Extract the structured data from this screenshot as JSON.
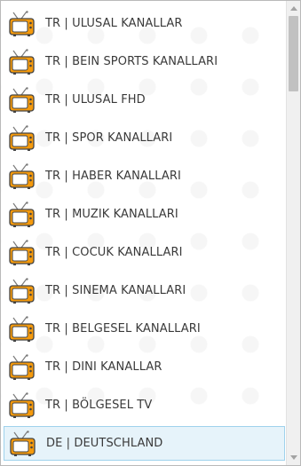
{
  "channels": [
    {
      "label": "TR | ULUSAL KANALLAR",
      "icon": "tv-icon",
      "selected": false
    },
    {
      "label": "TR | BEIN SPORTS KANALLARI",
      "icon": "tv-icon",
      "selected": false
    },
    {
      "label": "TR | ULUSAL FHD",
      "icon": "tv-icon",
      "selected": false
    },
    {
      "label": "TR | SPOR KANALLARI",
      "icon": "tv-icon",
      "selected": false
    },
    {
      "label": "TR | HABER KANALLARI",
      "icon": "tv-icon",
      "selected": false
    },
    {
      "label": "TR | MUZIK KANALLARI",
      "icon": "tv-icon",
      "selected": false
    },
    {
      "label": "TR | COCUK KANALLARI",
      "icon": "tv-icon",
      "selected": false
    },
    {
      "label": "TR | SINEMA KANALLARI",
      "icon": "tv-icon",
      "selected": false
    },
    {
      "label": "TR | BELGESEL KANALLARI",
      "icon": "tv-icon",
      "selected": false
    },
    {
      "label": "TR | DINI KANALLAR",
      "icon": "tv-icon",
      "selected": false
    },
    {
      "label": "TR | BÖLGESEL TV",
      "icon": "tv-icon",
      "selected": false
    },
    {
      "label": "DE | DEUTSCHLAND",
      "icon": "tv-icon",
      "selected": true
    }
  ],
  "colors": {
    "tv_body": "#f59a0c",
    "tv_screen": "#ffffff",
    "selected_bg": "#e6f3fa",
    "selected_border": "#9fd2ec",
    "text": "#3a3a3a"
  },
  "scrollbar": {
    "up_icon": "scroll-up-arrow-icon",
    "down_icon": "scroll-down-arrow-icon"
  }
}
